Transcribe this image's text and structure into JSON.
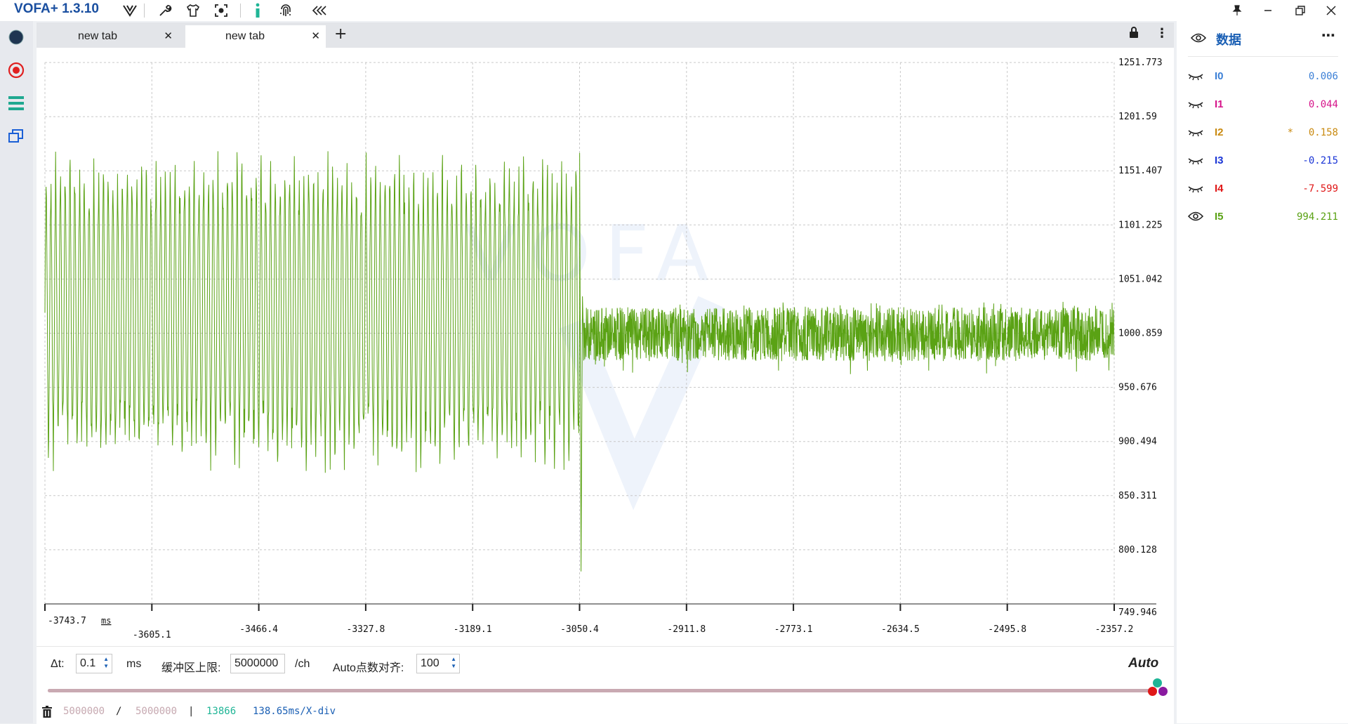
{
  "app": {
    "title": "VOFA+ 1.3.10"
  },
  "toolbar_icons": [
    "vofa-logo-icon",
    "wrench-icon",
    "shirt-icon",
    "capture-icon",
    "info-icon",
    "fingerprint-icon",
    "collapse-left-icon"
  ],
  "window_controls": [
    "pin-icon",
    "minimize-icon",
    "restore-icon",
    "close-icon"
  ],
  "left_sidebar": [
    "connect-dot-icon",
    "record-icon",
    "menu-lines-icon",
    "windows-icon"
  ],
  "tabs": [
    {
      "label": "new tab",
      "active": false
    },
    {
      "label": "new tab",
      "active": true
    }
  ],
  "chart_data": {
    "type": "line",
    "series": [
      {
        "name": "I5",
        "color": "#5aa214",
        "visible": true
      }
    ],
    "xlabel": "ms",
    "x_ticks": [
      "-3743.7",
      "-3605.1",
      "-3466.4",
      "-3327.8",
      "-3189.1",
      "-3050.4",
      "-2911.8",
      "-2773.1",
      "-2634.5",
      "-2495.8",
      "-2357.2"
    ],
    "y_ticks": [
      "1251.773",
      "1201.59",
      "1151.407",
      "1101.225",
      "1051.042",
      "1000.859",
      "950.676",
      "900.494",
      "850.311",
      "800.128",
      "749.946"
    ],
    "xlim": [
      -3743.7,
      -2357.2
    ],
    "ylim": [
      749.946,
      1251.773
    ],
    "segments": [
      {
        "x_start": -3743.7,
        "x_end": -3050.4,
        "shape": "oscillation",
        "center": 1000.0,
        "peak_max": 1170,
        "trough_min": 870,
        "cycles": 112
      },
      {
        "x_start": -3050.4,
        "x_end": -3050.4,
        "shape": "spike",
        "min": 780,
        "max": 1168
      },
      {
        "x_start": -3050.4,
        "x_end": -2357.2,
        "shape": "noise",
        "center": 1000.0,
        "band": [
          975,
          1025
        ],
        "peak_max": 1030,
        "trough_min": 962
      }
    ],
    "grid": true,
    "watermark": "VOFA"
  },
  "controls": {
    "dt_label": "Δt:",
    "dt_value": "0.1",
    "dt_unit": "ms",
    "buffer_label": "缓冲区上限:",
    "buffer_value": "5000000",
    "buffer_unit": "/ch",
    "auto_align_label": "Auto点数对齐:",
    "auto_align_value": "100",
    "auto_label": "Auto",
    "progress": 1.0
  },
  "status": {
    "trash_icon": "trash-icon",
    "buffer_used": "5000000",
    "separator": "/",
    "buffer_total": "5000000",
    "bar": "|",
    "count": "13866",
    "rate": "138.65ms/X-div"
  },
  "right_panel": {
    "title": "数据",
    "channels": [
      {
        "name": "I0",
        "value": "0.006",
        "color": "#3b7fd6",
        "visible": false,
        "star": ""
      },
      {
        "name": "I1",
        "value": "0.044",
        "color": "#d6148a",
        "visible": false,
        "star": ""
      },
      {
        "name": "I2",
        "value": "0.158",
        "color": "#c98a10",
        "visible": false,
        "star": "*"
      },
      {
        "name": "I3",
        "value": "-0.215",
        "color": "#1a35d6",
        "visible": false,
        "star": ""
      },
      {
        "name": "I4",
        "value": "-7.599",
        "color": "#e01818",
        "visible": false,
        "star": ""
      },
      {
        "name": "I5",
        "value": "994.211",
        "color": "#5aa214",
        "visible": true,
        "star": ""
      }
    ]
  }
}
